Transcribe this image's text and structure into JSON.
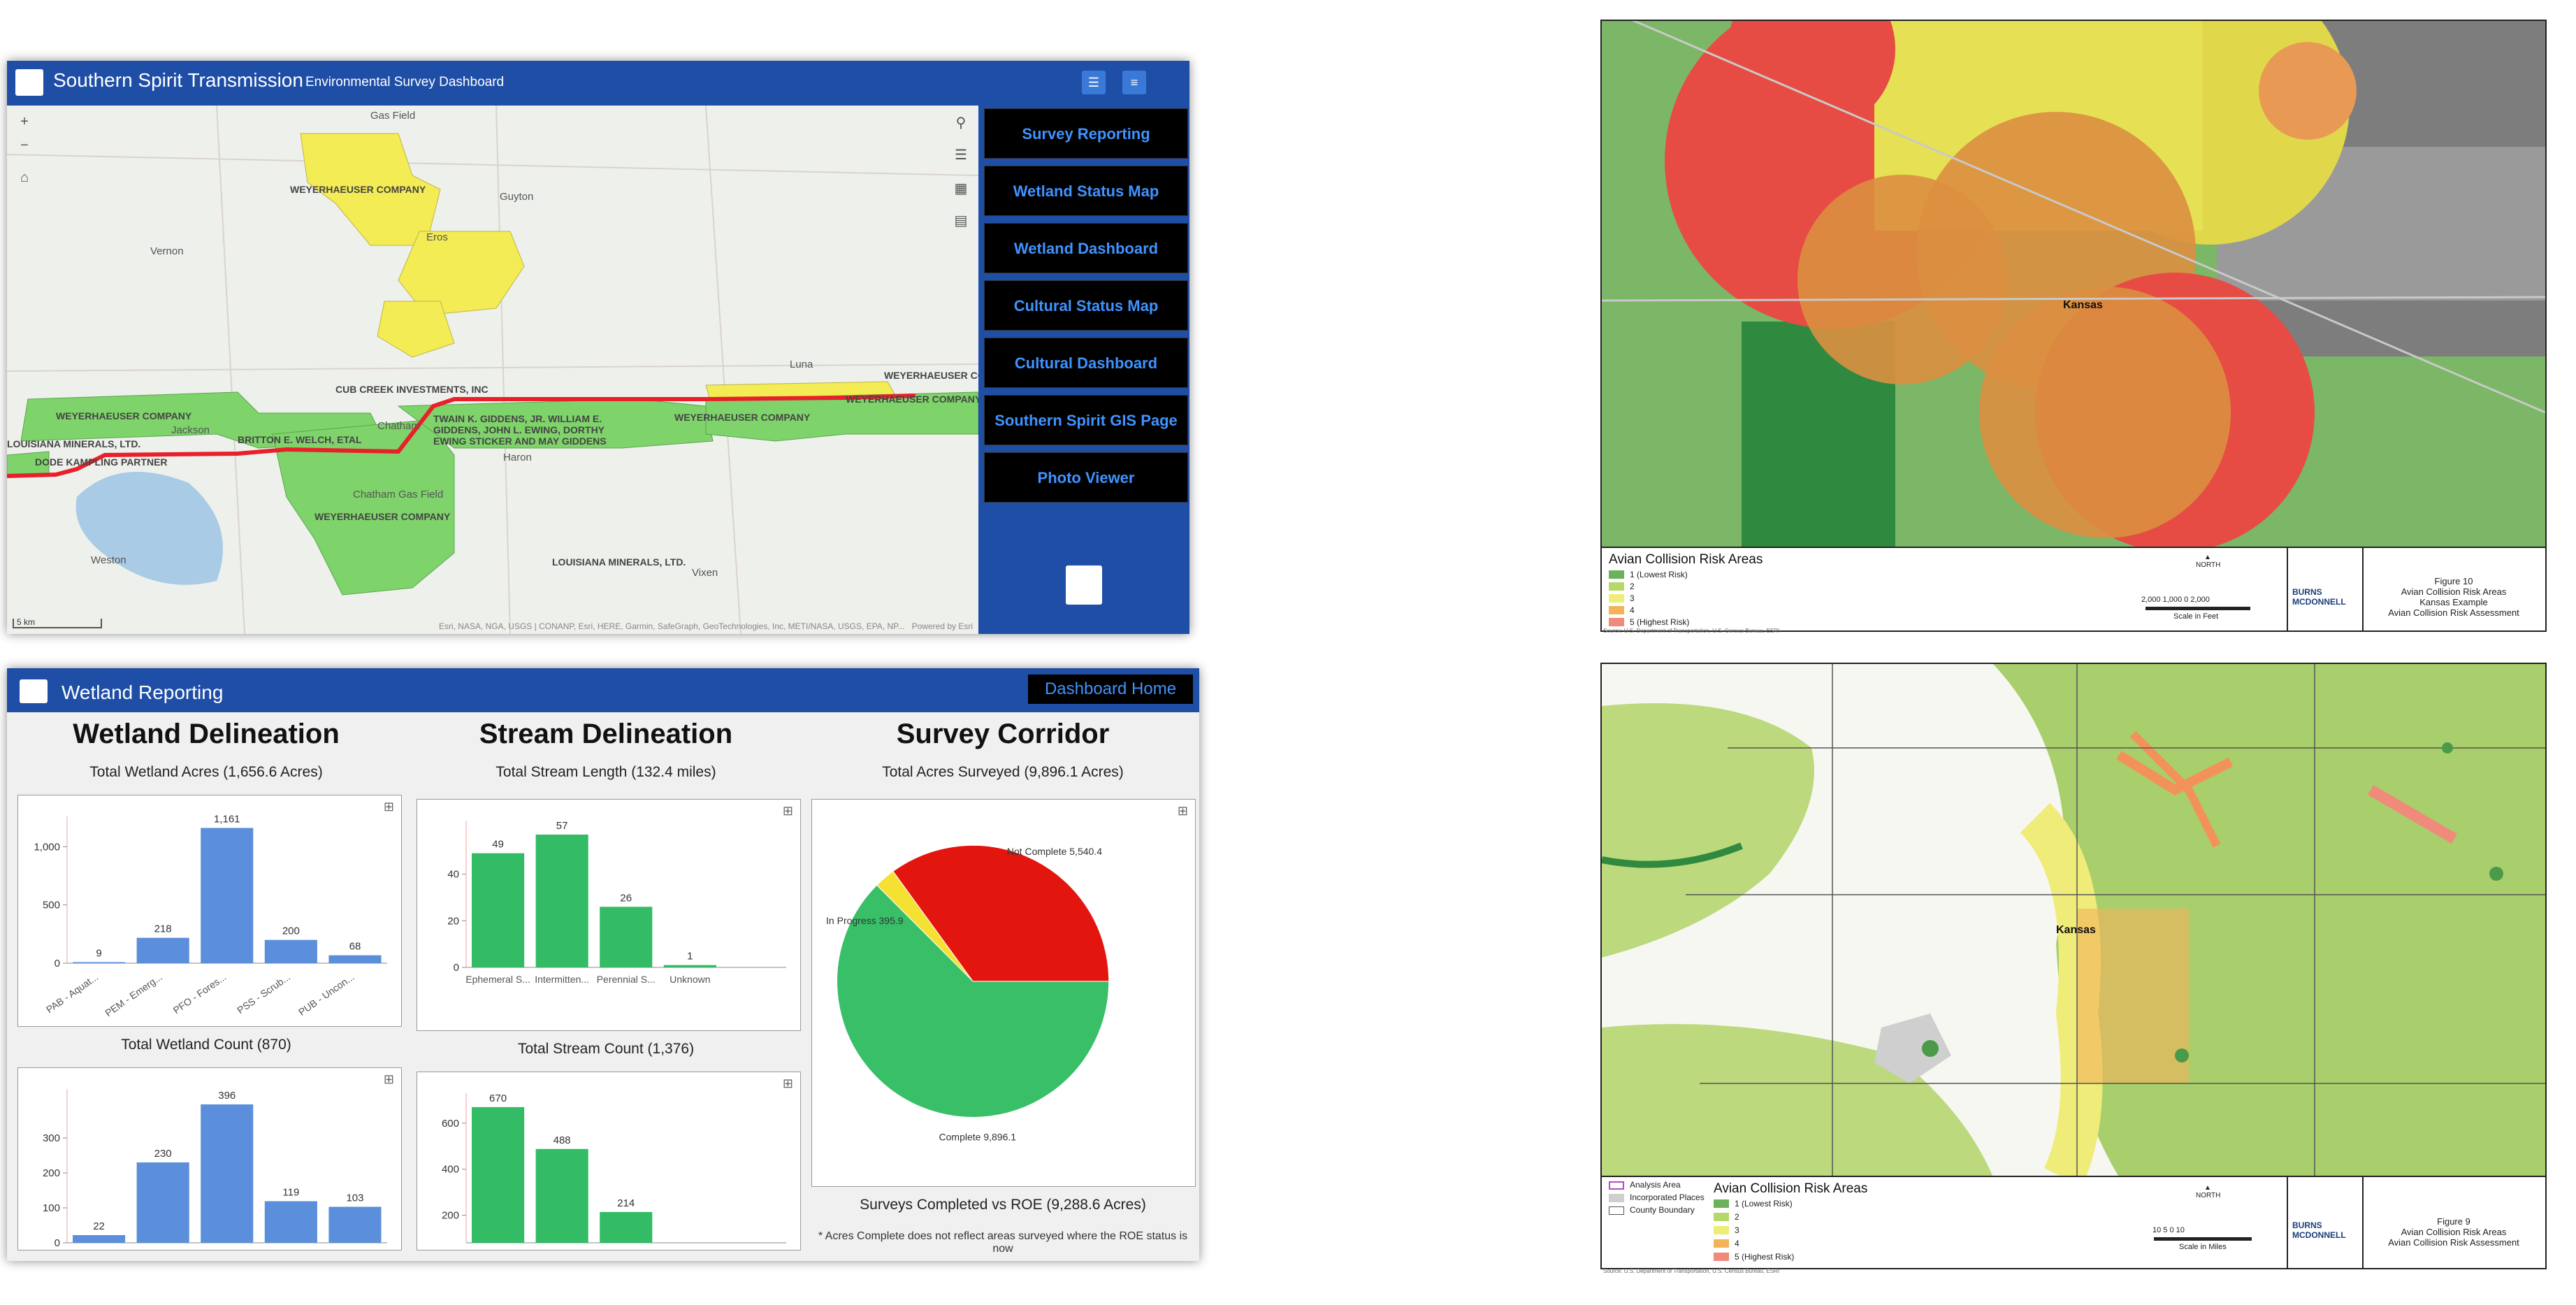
{
  "map_dashboard": {
    "title": "Southern Spirit Transmission",
    "subtitle": "Environmental Survey Dashboard",
    "header_icons": [
      "layers-icon",
      "list-icon"
    ],
    "tools": [
      "zoom-in-icon",
      "zoom-out-icon",
      "home-icon"
    ],
    "right_tools": [
      "search-icon",
      "layers-icon",
      "qr-icon",
      "basemap-icon"
    ],
    "nav_buttons": [
      "Survey Reporting",
      "Wetland Status Map",
      "Wetland Dashboard",
      "Cultural Status Map",
      "Cultural Dashboard",
      "Southern Spirit GIS Page",
      "Photo Viewer"
    ],
    "places": [
      "Gas Field",
      "Guyton",
      "Vernon",
      "Eros",
      "Luna",
      "Jackson",
      "Chatham",
      "Weston",
      "Vixen",
      "Haron",
      "Chatham Gas Field"
    ],
    "owners": [
      "WEYERHAEUSER COMPANY",
      "WEYERHAEUSER COMPANY",
      "WEYERHAEUSER COMPANY",
      "WEYERHAEUSER COMPANY",
      "WEYERHAEUSER COMPANY",
      "WEYERHAEUSER COMPANY",
      "CUB CREEK INVESTMENTS, INC",
      "LOUISIANA MINERALS, LTD.",
      "LOUISIANA MINERALS, LTD.",
      "TWAIN K. GIDDENS, JR. WILLIAM E. GIDDENS, JOHN L. EWING, DORTHY EWING STICKER AND MAY GIDDENS",
      "BRITTON E. WELCH, ETAL",
      "DODE KAMPLING PARTNER"
    ],
    "scale_label": "5 km",
    "attribution": "Esri, NASA, NGA, USGS | CONANP, Esri, HERE, Garmin, SafeGraph, GeoTechnologies, Inc, METI/NASA, USGS, EPA, NP...",
    "powered_by": "Powered by Esri",
    "colors": {
      "header": "#1f4ea6",
      "nav_text": "#3f93ff",
      "wetland": "#7ed36a",
      "yellow": "#f5ee5a",
      "route": "#e8202a"
    }
  },
  "wetland_report": {
    "title": "Wetland Reporting",
    "home_button": "Dashboard Home",
    "columns": [
      {
        "title": "Wetland Delineation",
        "sub1": "Total Wetland Acres (1,656.6 Acres)",
        "sub2": "Total Wetland Count (870)"
      },
      {
        "title": "Stream Delineation",
        "sub1": "Total Stream Length (132.4 miles)",
        "sub2": "Total Stream Count (1,376)"
      },
      {
        "title": "Survey Corridor",
        "sub1": "Total Acres Surveyed (9,896.1 Acres)",
        "sub2": "Surveys Completed vs ROE (9,288.6 Acres)"
      }
    ],
    "footnote": "* Acres Complete does not reflect areas surveyed where the ROE status is now"
  },
  "chart_data": [
    {
      "type": "bar",
      "id": "wetland_acres",
      "categories": [
        "PAB - Aquat...",
        "PEM - Emerg...",
        "PFO - Fores...",
        "PSS - Scrub...",
        "PUB - Uncon..."
      ],
      "values": [
        9,
        218,
        1161,
        200,
        68
      ],
      "value_labels": [
        "9",
        "218",
        "1,161",
        "200",
        "68"
      ],
      "yticks": [
        "0",
        "500",
        "1,000"
      ],
      "ylim": [
        0,
        1200
      ],
      "color": "#5b8fdc"
    },
    {
      "type": "bar",
      "id": "wetland_count",
      "categories": [
        "",
        "",
        "",
        "",
        ""
      ],
      "values": [
        22,
        230,
        396,
        119,
        103
      ],
      "value_labels": [
        "22",
        "230",
        "396",
        "119",
        "103"
      ],
      "yticks": [
        "0",
        "100",
        "200",
        "300"
      ],
      "ylim": [
        0,
        420
      ],
      "color": "#5b8fdc"
    },
    {
      "type": "bar",
      "id": "stream_length",
      "categories": [
        "Ephemeral S...",
        "Intermitten...",
        "Perennial S...",
        "Unknown"
      ],
      "values": [
        49,
        57,
        26,
        1
      ],
      "value_labels": [
        "49",
        "57",
        "26",
        "1"
      ],
      "yticks": [
        "0",
        "20",
        "40"
      ],
      "ylim": [
        0,
        60
      ],
      "color": "#33bb66"
    },
    {
      "type": "bar",
      "id": "stream_count",
      "categories": [
        "",
        "",
        ""
      ],
      "values": [
        670,
        488,
        214
      ],
      "value_labels": [
        "670",
        "488",
        "214"
      ],
      "yticks": [
        "200",
        "400",
        "600"
      ],
      "ylim": [
        80,
        700
      ],
      "color": "#33bb66"
    },
    {
      "type": "pie",
      "id": "survey_corridor",
      "slices": [
        {
          "label": "Complete",
          "value": 9896.1,
          "display": "Complete 9,896.1",
          "color": "#38bf68"
        },
        {
          "label": "In Progress",
          "value": 395.9,
          "display": "In Progress 395.9",
          "color": "#f5e132"
        },
        {
          "label": "Not Complete",
          "value": 5540.4,
          "display": "Not Complete 5,540.4",
          "color": "#e3150f"
        }
      ]
    }
  ],
  "figure10": {
    "legend_title": "Avian Collision Risk Areas",
    "legend": [
      {
        "label": "1 (Lowest Risk)",
        "color": "#6bb35a"
      },
      {
        "label": "2",
        "color": "#b6d86b"
      },
      {
        "label": "3",
        "color": "#eeee77"
      },
      {
        "label": "4",
        "color": "#f4b35a"
      },
      {
        "label": "5 (Highest Risk)",
        "color": "#f08a7a"
      }
    ],
    "place": "Kansas",
    "north": "NORTH",
    "scale_ticks": "2,000   1,000   0             2,000",
    "scale_unit": "Scale in Feet",
    "logo": "BURNS MCDONNELL",
    "caption": [
      "Figure 10",
      "Avian Collision Risk Areas",
      "Kansas Example",
      "Avian Collision Risk Assessment"
    ],
    "source": "Source: U.S. Department of Transportation, U.S. Census Bureau, ESRI"
  },
  "figure9": {
    "legend_left": [
      {
        "label": "Analysis Area",
        "color": "#b44cc7"
      },
      {
        "label": "Incorporated Places",
        "color": "#cfcfcf"
      },
      {
        "label": "County Boundary",
        "color": "#ffffff"
      }
    ],
    "legend_title": "Avian Collision Risk Areas",
    "legend": [
      {
        "label": "1 (Lowest Risk)",
        "color": "#6bb35a"
      },
      {
        "label": "2",
        "color": "#b6d86b"
      },
      {
        "label": "3",
        "color": "#eeee77"
      },
      {
        "label": "4",
        "color": "#f4b35a"
      },
      {
        "label": "5 (Highest Risk)",
        "color": "#f08a7a"
      }
    ],
    "place": "Kansas",
    "north": "NORTH",
    "scale_ticks": "10     5      0           10",
    "scale_unit": "Scale in Miles",
    "logo": "BURNS MCDONNELL",
    "caption": [
      "Figure 9",
      "Avian Collision Risk Areas",
      "Avian Collision Risk Assessment"
    ],
    "source": "Source: U.S. Department of Transportation, U.S. Census Bureau, ESRI"
  }
}
